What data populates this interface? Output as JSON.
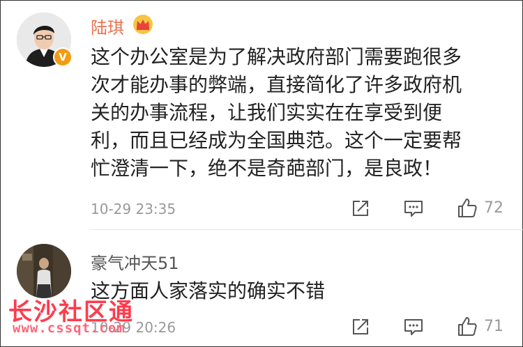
{
  "comments": [
    {
      "user": "陆琪",
      "verified": true,
      "verified_badge": "V",
      "crown_icon": "crown-icon",
      "text_lines": [
        "这个办公室是为了解决政府部门需要跑很多",
        "次才能办事的弊端，直接简化了许多政府机",
        "关的办事流程，让我们实实在在享受到便",
        "利，而且已经成为全国典范。这个一定要帮",
        "忙澄清一下，绝不是奇葩部门，是良政！"
      ],
      "time": "10-29 23:35",
      "likes": "72"
    },
    {
      "user": "豪气冲天51",
      "text_lines": [
        "这方面人家落实的确实不错"
      ],
      "time": "10-29 20:26",
      "likes": "71"
    }
  ],
  "watermark": {
    "title": "长沙社区通",
    "url": "www.cssqt.com"
  },
  "colors": {
    "vip_name": "#eb7350",
    "meta_text": "#999999",
    "watermark": "#ff3b4d",
    "badge": "#f39c12"
  }
}
